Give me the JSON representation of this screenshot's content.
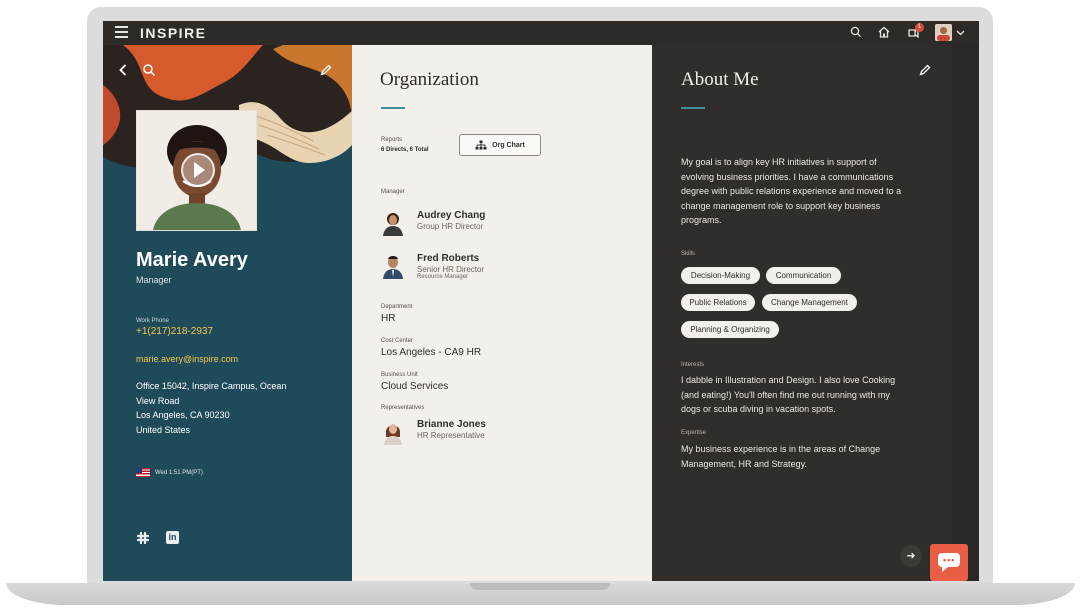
{
  "app": {
    "brand": "INSPIRE",
    "notification_count": "1"
  },
  "profile": {
    "name": "Marie Avery",
    "title": "Manager",
    "work_phone_label": "Work Phone",
    "work_phone": "+1(217)218-2937",
    "email": "marie.avery@inspire.com",
    "address_lines": [
      "Office 15042, Inspire Campus, Ocean",
      "View Road",
      "Los Angeles, CA 90230",
      "United States"
    ],
    "local_time": "Wed 1:51 PM(PT)"
  },
  "organization": {
    "heading": "Organization",
    "reports_label": "Reports",
    "reports_value": "6 Directs, 6 Total",
    "org_chart_label": "Org Chart",
    "manager_label": "Manager",
    "manager": {
      "name": "Audrey Chang",
      "role": "Group HR Director"
    },
    "second_contact": {
      "name": "Fred Roberts",
      "role": "Senior HR Director",
      "subrole": "Resource Manager"
    },
    "department_label": "Department",
    "department": "HR",
    "cost_center_label": "Cost Center",
    "cost_center": "Los Angeles - CA9 HR",
    "business_unit_label": "Business Unit",
    "business_unit": "Cloud Services",
    "representatives_label": "Representatives",
    "representative": {
      "name": "Brianne Jones",
      "role": "HR Representative"
    }
  },
  "about": {
    "heading": "About Me",
    "bio_lines": [
      "My goal is to align key HR initiatives in support of",
      "evolving business priorities. I have a communications",
      "degree with public relations experience and moved to a",
      "change management role to support key business",
      "programs."
    ],
    "skills_label": "Skills",
    "skills": [
      "Decision-Making",
      "Communication",
      "Public Relations",
      "Change Management",
      "Planning & Organizing"
    ],
    "interests_label": "Interests",
    "interests_lines": [
      "I dabble in Illustration and Design. I also love Cooking",
      "(and eating!) You'll often find me out running with my",
      "dogs or scuba diving in vacation spots."
    ],
    "expertise_label": "Expertise",
    "expertise_lines": [
      "My business experience is in the areas of Change",
      "Management, HR and Strategy."
    ]
  },
  "colors": {
    "topbar": "#2d2a27",
    "left_panel": "#1f4a5a",
    "middle_panel": "#f3efea",
    "right_panel": "#312d2a",
    "link": "#f2c94c",
    "accent": "#3e8fa0",
    "chat": "#e85e45"
  }
}
